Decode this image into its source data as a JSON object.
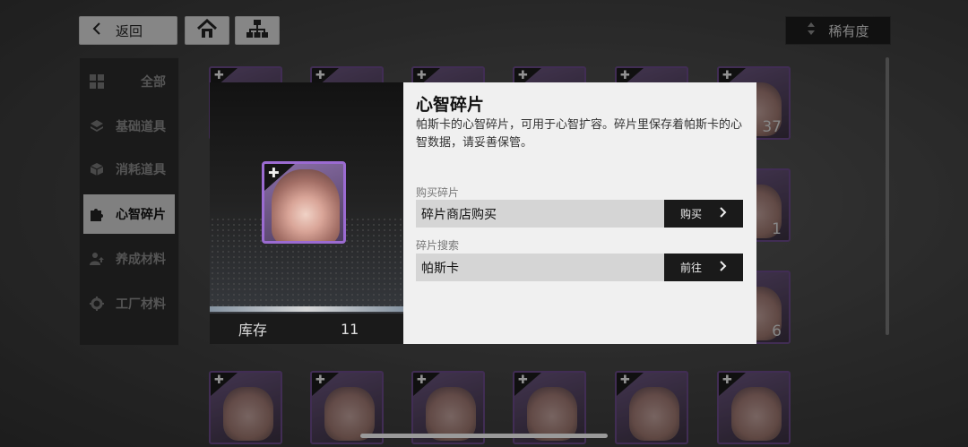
{
  "topbar": {
    "back_label": "返回",
    "back_icon": "chevron-left-icon",
    "home_icon": "home-icon",
    "tree_icon": "hierarchy-icon",
    "rarity_label": "稀有度",
    "rarity_icon": "sort-arrows-icon"
  },
  "sidebar": {
    "items": [
      {
        "label": "全部",
        "icon": "grid-icon",
        "active": false
      },
      {
        "label": "基础道具",
        "icon": "layers-icon",
        "active": false
      },
      {
        "label": "消耗道具",
        "icon": "cube-icon",
        "active": false
      },
      {
        "label": "心智碎片",
        "icon": "puzzle-icon",
        "active": true
      },
      {
        "label": "养成材料",
        "icon": "user-upgrade-icon",
        "active": false
      },
      {
        "label": "工厂材料",
        "icon": "gear-icon",
        "active": false
      }
    ]
  },
  "grid": {
    "visible_counts": [
      "37",
      "1",
      "6"
    ]
  },
  "modal": {
    "title": "心智碎片",
    "description": "帕斯卡的心智碎片，可用于心智扩容。碎片里保存着帕斯卡的心智数据，请妥善保管。",
    "stock_label": "库存",
    "stock_value": "11",
    "buy_section": "购买碎片",
    "buy_row_text": "碎片商店购买",
    "buy_button": "购买",
    "search_section": "碎片搜索",
    "search_row_text": "帕斯卡",
    "search_button": "前往"
  },
  "colors": {
    "accent_purple": "#9b6bd1",
    "panel_light": "#f0f0f0",
    "button_dark": "#1a1a1a"
  }
}
